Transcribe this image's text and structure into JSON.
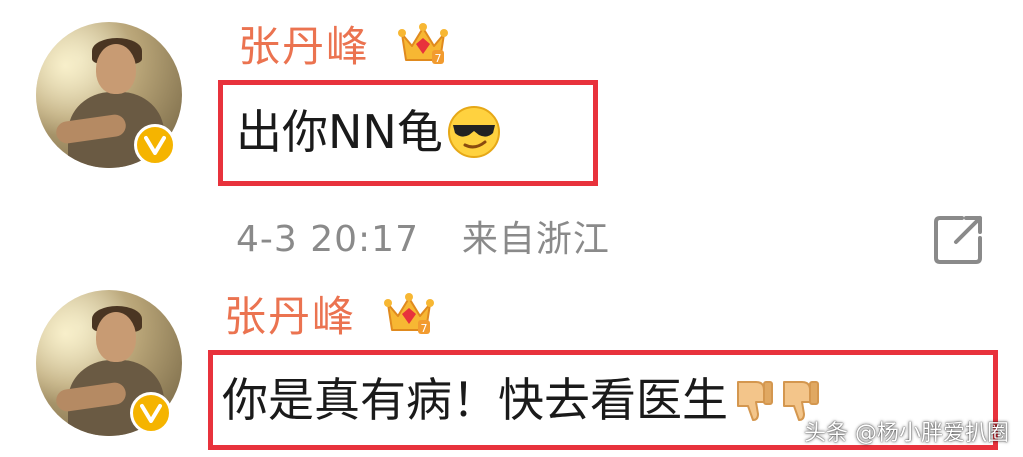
{
  "comments": [
    {
      "username": "张丹峰",
      "text": "出你NN龟",
      "emoji": "sunglasses-face",
      "timestamp": "4-3 20:17",
      "location": "来自浙江",
      "badge": "vip-crown",
      "verified": true
    },
    {
      "username": "张丹峰",
      "text": "你是真有病！快去看医生",
      "emoji": "thumbs-down",
      "emoji_count": 2,
      "badge": "vip-crown",
      "verified": true
    }
  ],
  "actions": {
    "share_icon": "share-icon"
  },
  "watermark": "头条 @杨小胖爱扒圈",
  "colors": {
    "username": "#eb7350",
    "highlight_border": "#e8323c",
    "meta_text": "#8a8a8a",
    "verify_badge": "#f5b400"
  }
}
